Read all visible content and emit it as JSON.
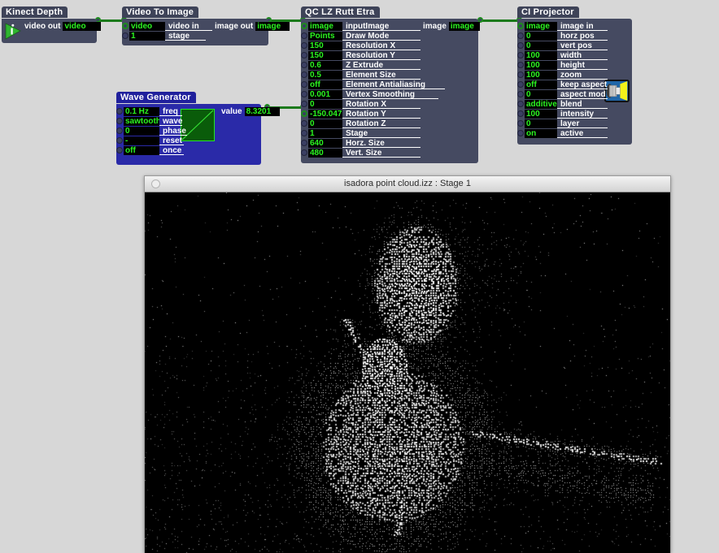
{
  "app": {
    "background_color": "#d7d7d7",
    "node_title_color": "#3e4358",
    "node_body_color": "#454a61",
    "selected_color": "#2a2aa8",
    "value_text_color": "#2bf520",
    "wire_color": "#1b7a1b"
  },
  "nodes": [
    {
      "id": "kinect-depth",
      "title": "Kinect Depth",
      "icon": "izzy-logo-icon",
      "inputs": [],
      "outputs": [
        {
          "label": "video out",
          "value": "video"
        }
      ]
    },
    {
      "id": "video-to-image",
      "title": "Video To Image",
      "inputs": [
        {
          "value": "video",
          "label": "video in",
          "connected": true
        },
        {
          "value": "1",
          "label": "stage",
          "connected": false
        }
      ],
      "outputs": [
        {
          "label": "image out",
          "value": "image"
        }
      ]
    },
    {
      "id": "qc-lz-rutt-etra",
      "title": "QC LZ Rutt Etra",
      "inputs": [
        {
          "value": "image",
          "label": "inputImage",
          "connected": true
        },
        {
          "value": "Points",
          "label": "Draw Mode",
          "connected": false
        },
        {
          "value": "150",
          "label": "Resolution X",
          "connected": false
        },
        {
          "value": "150",
          "label": "Resolution Y",
          "connected": false
        },
        {
          "value": "0.6",
          "label": "Z Extrude",
          "connected": false
        },
        {
          "value": "0.5",
          "label": "Element Size",
          "connected": false
        },
        {
          "value": "off",
          "label": "Element Antialiasing",
          "connected": false
        },
        {
          "value": "0.001",
          "label": "Vertex Smoothing",
          "connected": false
        },
        {
          "value": "0",
          "label": "Rotation X",
          "connected": false
        },
        {
          "value": "-150.047",
          "label": "Rotation Y",
          "connected": true
        },
        {
          "value": "0",
          "label": "Rotation Z",
          "connected": false
        },
        {
          "value": "1",
          "label": "Stage",
          "connected": false
        },
        {
          "value": "640",
          "label": "Horz. Size",
          "connected": false
        },
        {
          "value": "480",
          "label": "Vert. Size",
          "connected": false
        }
      ],
      "outputs": [
        {
          "label": "image",
          "value": "image"
        }
      ]
    },
    {
      "id": "ci-projector",
      "title": "CI Projector",
      "icon": "projector-icon",
      "inputs": [
        {
          "value": "image",
          "label": "image in",
          "connected": true
        },
        {
          "value": "0",
          "label": "horz pos",
          "connected": false
        },
        {
          "value": "0",
          "label": "vert pos",
          "connected": false
        },
        {
          "value": "100",
          "label": "width",
          "connected": false
        },
        {
          "value": "100",
          "label": "height",
          "connected": false
        },
        {
          "value": "100",
          "label": "zoom",
          "connected": false
        },
        {
          "value": "off",
          "label": "keep aspect",
          "connected": false
        },
        {
          "value": "0",
          "label": "aspect mod",
          "connected": false
        },
        {
          "value": "additive",
          "label": "blend",
          "connected": false
        },
        {
          "value": "100",
          "label": "intensity",
          "connected": false
        },
        {
          "value": "0",
          "label": "layer",
          "connected": false
        },
        {
          "value": "on",
          "label": "active",
          "connected": false
        }
      ],
      "outputs": []
    },
    {
      "id": "wave-generator",
      "title": "Wave Generator",
      "selected": true,
      "thumbnail": "sawtooth-waveform",
      "inputs": [
        {
          "value": "0.1 Hz",
          "label": "freq",
          "connected": false
        },
        {
          "value": "sawtooth",
          "label": "wave",
          "connected": false
        },
        {
          "value": "0",
          "label": "phase",
          "connected": false
        },
        {
          "value": "-",
          "label": "reset",
          "connected": false
        },
        {
          "value": "off",
          "label": "once",
          "connected": false
        }
      ],
      "outputs": [
        {
          "label": "value",
          "value": "8.3201"
        }
      ]
    }
  ],
  "stage": {
    "title": "isadora point cloud.izz : Stage 1",
    "close_button": "close-button",
    "canvas_description": "point cloud render of seated person"
  }
}
